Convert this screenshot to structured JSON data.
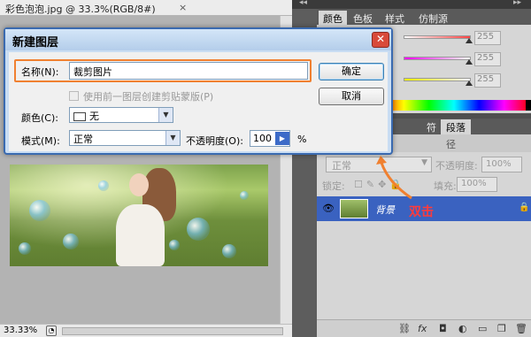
{
  "document": {
    "tab_title": "彩色泡泡.jpg @ 33.3%(RGB/8#)",
    "close_glyph": "×",
    "zoom": "33.33%"
  },
  "color_panel": {
    "tabs": [
      "颜色",
      "色板",
      "样式",
      "仿制源"
    ],
    "values": [
      "255",
      "255",
      "255"
    ]
  },
  "mid_panel": {
    "tabs": [
      "符",
      "段落"
    ],
    "partial_text": "径"
  },
  "layers": {
    "blend_mode": "正常",
    "opacity_label": "不透明度:",
    "opacity_value": "100%",
    "lock_label": "锁定:",
    "fill_label": "填充:",
    "fill_value": "100%",
    "layer_name": "背景"
  },
  "annotation": {
    "text": "双击",
    "color": "#ff3b3b"
  },
  "dialog": {
    "title": "新建图层",
    "close_glyph": "✕",
    "name_label": "名称(N):",
    "name_value": "裁剪图片",
    "checkbox_label": "使用前一图层创建剪贴蒙版(P)",
    "color_label": "颜色(C):",
    "color_value": "无",
    "mode_label": "模式(M):",
    "mode_value": "正常",
    "opacity_label": "不透明度(O):",
    "opacity_value": "100",
    "opacity_unit": "%",
    "ok_label": "确定",
    "cancel_label": "取消"
  },
  "icons": {
    "eye": "eye-icon",
    "lock": "lock-icon",
    "link": "link-icon",
    "fx": "fx-icon",
    "mask": "mask-icon",
    "adjustment": "adjustment-icon",
    "group": "folder-icon",
    "new_layer": "new-layer-icon",
    "trash": "trash-icon"
  }
}
